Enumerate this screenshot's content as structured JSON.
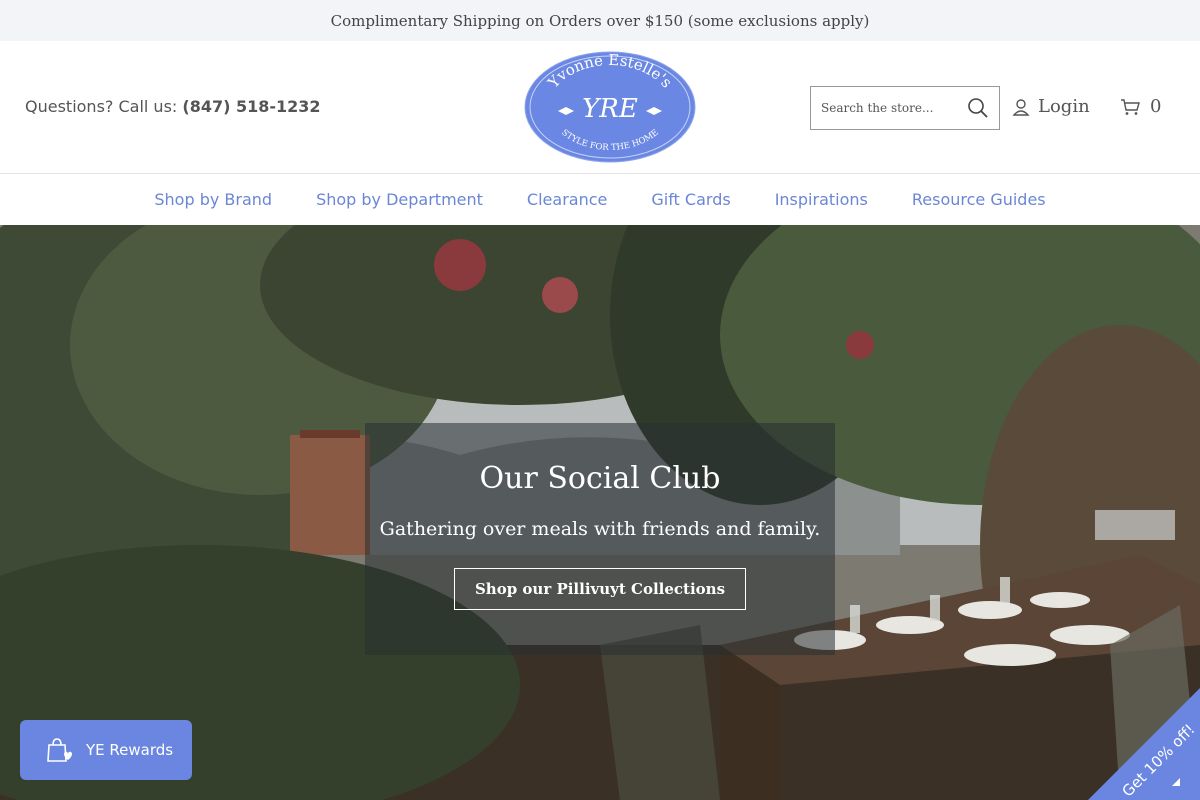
{
  "announcement": "Complimentary Shipping on Orders over $150 (some exclusions apply)",
  "header": {
    "phone_label": "Questions? Call us: ",
    "phone_number": "(847) 518-1232",
    "logo": {
      "top_text": "Yvonne Estelle's",
      "bottom_text": "STYLE FOR THE HOME",
      "monogram": "YRE"
    },
    "search_placeholder": "Search the store...",
    "login_label": "Login",
    "cart_count": "0"
  },
  "nav": {
    "items": [
      {
        "label": "Shop by Brand"
      },
      {
        "label": "Shop by Department"
      },
      {
        "label": "Clearance"
      },
      {
        "label": "Gift Cards"
      },
      {
        "label": "Inspirations"
      },
      {
        "label": "Resource Guides"
      }
    ]
  },
  "hero": {
    "title": "Our Social Club",
    "subtitle": "Gathering over meals with friends and family.",
    "cta_label": "Shop our Pillivuyt Collections"
  },
  "rewards": {
    "label": "YE Rewards"
  },
  "promo_ribbon": {
    "label": "Get 10% off!"
  },
  "colors": {
    "accent": "#6b86d6",
    "rewards_bg": "#6b86e0",
    "logo_bg": "#6a88e3",
    "announcement_bg": "#f3f4f8"
  }
}
